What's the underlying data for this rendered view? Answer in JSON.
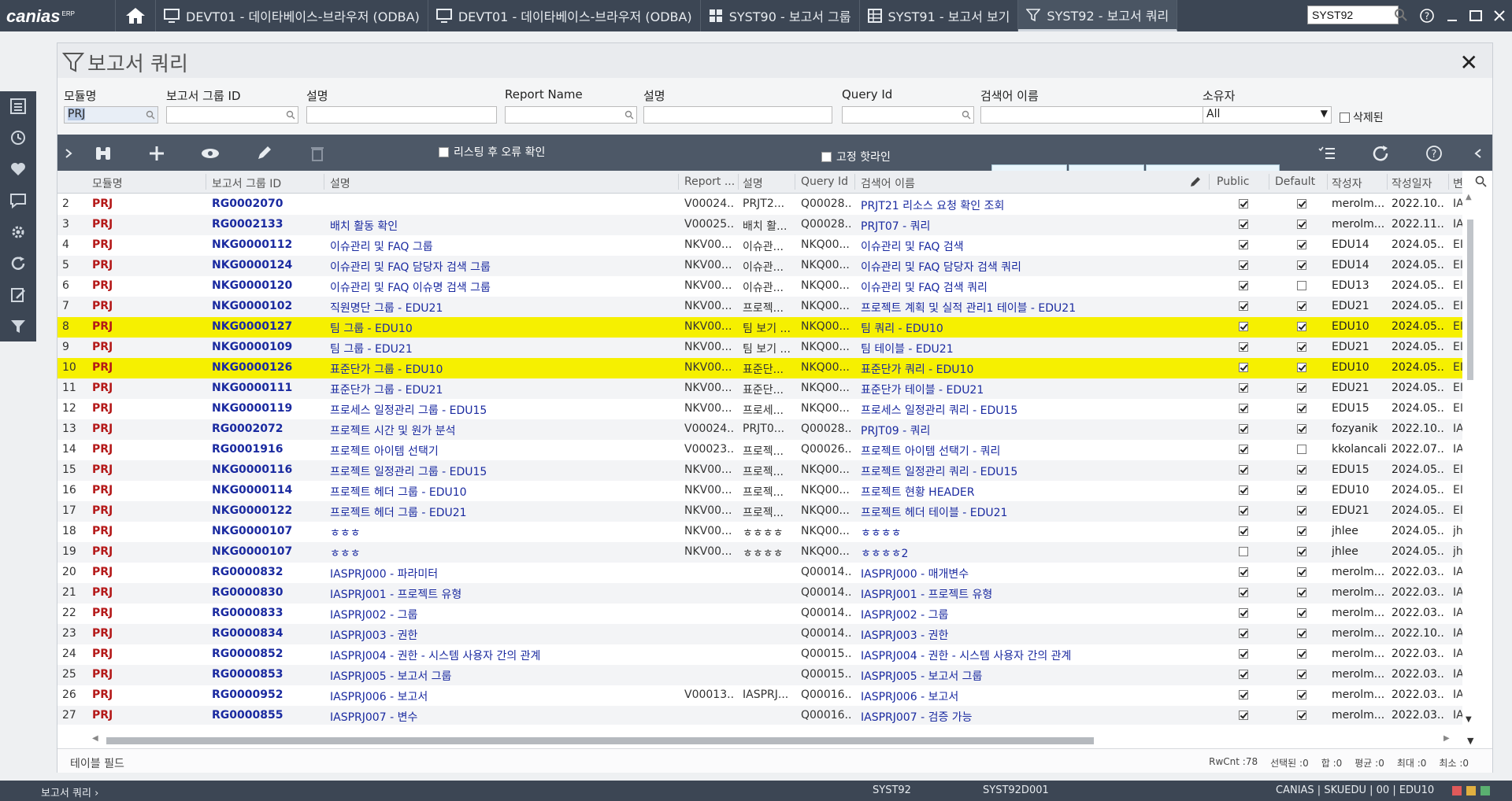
{
  "app": {
    "logo": "canias",
    "logo_sup": "ERP",
    "tabs": [
      {
        "label": "DEVT01 - 데이타베이스-브라우저 (ODBA)",
        "icon": "monitor-icon"
      },
      {
        "label": "DEVT01 - 데이타베이스-브라우저 (ODBA)",
        "icon": "monitor-icon"
      },
      {
        "label": "SYST90 - 보고서 그룹",
        "icon": "grid-icon"
      },
      {
        "label": "SYST91 - 보고서 보기",
        "icon": "table-icon"
      },
      {
        "label": "SYST92 - 보고서 쿼리",
        "icon": "filter-icon"
      }
    ],
    "global_search": "SYST92"
  },
  "panel": {
    "title": "보고서 쿼리"
  },
  "filters": {
    "module_label": "모듈명",
    "module_value": "PRJ",
    "group_id_label": "보고서 그룹 ID",
    "desc1_label": "설명",
    "report_name_label": "Report Name",
    "desc2_label": "설명",
    "query_id_label": "Query Id",
    "search_name_label": "검색어 이름",
    "owner_label": "소유자",
    "owner_value": "All",
    "deleted_label": "삭제된"
  },
  "toolbar": {
    "error_check_label": "리스팅 후 오류 확인",
    "fixed_row_label": "고정 핫라인"
  },
  "grid": {
    "columns": [
      "모듈명",
      "보고서 그룹 ID",
      "설명",
      "Report ...",
      "설명",
      "Query Id",
      "검색어 이름",
      "Public",
      "Default",
      "작성자",
      "작성일자",
      "변"
    ],
    "rows": [
      {
        "no": "2",
        "mod": "PRJ",
        "grp": "RG0002070",
        "desc": "",
        "rep": "V00024...",
        "desc2": "PRJT2...",
        "qid": "Q00028...",
        "srch": "PRJT21 리소스 요청 확인 조회",
        "pub": true,
        "def": true,
        "own": "merolm...",
        "date": "2022.10...",
        "x": "IA",
        "hl": false
      },
      {
        "no": "3",
        "mod": "PRJ",
        "grp": "RG0002133",
        "desc": "배치 활동 확인",
        "rep": "V00025...",
        "desc2": "배치 활...",
        "qid": "Q00028...",
        "srch": "PRJT07 - 쿼리",
        "pub": true,
        "def": true,
        "own": "merolm...",
        "date": "2022.11...",
        "x": "IA",
        "hl": false
      },
      {
        "no": "4",
        "mod": "PRJ",
        "grp": "NKG0000112",
        "desc": "이슈관리 및 FAQ 그룹",
        "rep": "NKV00...",
        "desc2": "이슈관...",
        "qid": "NKQ00...",
        "srch": "이슈관리 및 FAQ 검색",
        "pub": true,
        "def": true,
        "own": "EDU14",
        "date": "2024.05...",
        "x": "EI",
        "hl": false
      },
      {
        "no": "5",
        "mod": "PRJ",
        "grp": "NKG0000124",
        "desc": "이슈관리 및 FAQ 담당자 검색 그룹",
        "rep": "NKV00...",
        "desc2": "이슈관...",
        "qid": "NKQ00...",
        "srch": "이슈관리 및 FAQ 담당자 검색 쿼리",
        "pub": true,
        "def": true,
        "own": "EDU14",
        "date": "2024.05...",
        "x": "EI",
        "hl": false
      },
      {
        "no": "6",
        "mod": "PRJ",
        "grp": "NKG0000120",
        "desc": "이슈관리 및 FAQ 이슈명 검색 그룹",
        "rep": "NKV00...",
        "desc2": "이슈관...",
        "qid": "NKQ00...",
        "srch": "이슈관리 및 FAQ 검색 쿼리",
        "pub": true,
        "def": false,
        "own": "EDU13",
        "date": "2024.05...",
        "x": "EI",
        "hl": false
      },
      {
        "no": "7",
        "mod": "PRJ",
        "grp": "NKG0000102",
        "desc": "직원명단 그룹 - EDU21",
        "rep": "NKV00...",
        "desc2": "프로젝...",
        "qid": "NKQ00...",
        "srch": "프로젝트 계획 및 실적 관리1 테이블 - EDU21",
        "pub": true,
        "def": true,
        "own": "EDU21",
        "date": "2024.05...",
        "x": "EI",
        "hl": false
      },
      {
        "no": "8",
        "mod": "PRJ",
        "grp": "NKG0000127",
        "desc": "팀 그룹 - EDU10",
        "rep": "NKV00...",
        "desc2": "팀 보기 ...",
        "qid": "NKQ00...",
        "srch": "팀 쿼리 - EDU10",
        "pub": true,
        "def": true,
        "own": "EDU10",
        "date": "2024.05...",
        "x": "EI",
        "hl": true
      },
      {
        "no": "9",
        "mod": "PRJ",
        "grp": "NKG0000109",
        "desc": "팀 그룹 - EDU21",
        "rep": "NKV00...",
        "desc2": "팀 보기 ...",
        "qid": "NKQ00...",
        "srch": "팀 테이블 - EDU21",
        "pub": true,
        "def": true,
        "own": "EDU21",
        "date": "2024.05...",
        "x": "EI",
        "hl": false
      },
      {
        "no": "10",
        "mod": "PRJ",
        "grp": "NKG0000126",
        "desc": "표준단가 그룹 - EDU10",
        "rep": "NKV00...",
        "desc2": "표준단...",
        "qid": "NKQ00...",
        "srch": "표준단가 쿼리 - EDU10",
        "pub": true,
        "def": true,
        "own": "EDU10",
        "date": "2024.05...",
        "x": "EI",
        "hl": true
      },
      {
        "no": "11",
        "mod": "PRJ",
        "grp": "NKG0000111",
        "desc": "표준단가 그룹 - EDU21",
        "rep": "NKV00...",
        "desc2": "표준단...",
        "qid": "NKQ00...",
        "srch": "표준단가 테이블 - EDU21",
        "pub": true,
        "def": true,
        "own": "EDU21",
        "date": "2024.05...",
        "x": "EI",
        "hl": false
      },
      {
        "no": "12",
        "mod": "PRJ",
        "grp": "NKG0000119",
        "desc": "프로세스 일정관리  그룹 - EDU15",
        "rep": "NKV00...",
        "desc2": "프로세...",
        "qid": "NKQ00...",
        "srch": "프로세스 일정관리 쿼리 - EDU15",
        "pub": true,
        "def": true,
        "own": "EDU15",
        "date": "2024.05...",
        "x": "EI",
        "hl": false
      },
      {
        "no": "13",
        "mod": "PRJ",
        "grp": "RG0002072",
        "desc": "프로젝트 시간 및 원가 분석",
        "rep": "V00024...",
        "desc2": "PRJT0...",
        "qid": "Q00028...",
        "srch": "PRJT09 - 쿼리",
        "pub": true,
        "def": true,
        "own": "fozyanik",
        "date": "2022.10...",
        "x": "IA",
        "hl": false
      },
      {
        "no": "14",
        "mod": "PRJ",
        "grp": "RG0001916",
        "desc": "프로젝트 아이템 선택기",
        "rep": "V00023...",
        "desc2": "프로젝...",
        "qid": "Q00026...",
        "srch": "프로젝트 아이템 선택기 - 쿼리",
        "pub": true,
        "def": false,
        "own": "kkolancali",
        "date": "2022.07...",
        "x": "IA",
        "hl": false
      },
      {
        "no": "15",
        "mod": "PRJ",
        "grp": "NKG0000116",
        "desc": "프로젝트 일정관리  그룹 - EDU15",
        "rep": "NKV00...",
        "desc2": "프로젝...",
        "qid": "NKQ00...",
        "srch": "프로젝트 일정관리 쿼리 - EDU15",
        "pub": true,
        "def": true,
        "own": "EDU15",
        "date": "2024.05...",
        "x": "EI",
        "hl": false
      },
      {
        "no": "16",
        "mod": "PRJ",
        "grp": "NKG0000114",
        "desc": "프로젝트 헤더 그룹 - EDU10",
        "rep": "NKV00...",
        "desc2": "프로젝...",
        "qid": "NKQ00...",
        "srch": "프로젝트 현황 HEADER",
        "pub": true,
        "def": true,
        "own": "EDU10",
        "date": "2024.05...",
        "x": "EI",
        "hl": false
      },
      {
        "no": "17",
        "mod": "PRJ",
        "grp": "NKG0000122",
        "desc": "프로젝트 헤더 그룹 - EDU21",
        "rep": "NKV00...",
        "desc2": "프로젝...",
        "qid": "NKQ00...",
        "srch": "프로젝트 헤더 테이블 - EDU21",
        "pub": true,
        "def": true,
        "own": "EDU21",
        "date": "2024.05...",
        "x": "EI",
        "hl": false
      },
      {
        "no": "18",
        "mod": "PRJ",
        "grp": "NKG0000107",
        "desc": "ㅎㅎㅎ",
        "rep": "NKV00...",
        "desc2": "ㅎㅎㅎㅎ",
        "qid": "NKQ00...",
        "srch": "ㅎㅎㅎㅎ",
        "pub": true,
        "def": true,
        "own": "jhlee",
        "date": "2024.05...",
        "x": "jh",
        "hl": false
      },
      {
        "no": "19",
        "mod": "PRJ",
        "grp": "NKG0000107",
        "desc": "ㅎㅎㅎ",
        "rep": "NKV00...",
        "desc2": "ㅎㅎㅎㅎ",
        "qid": "NKQ00...",
        "srch": "ㅎㅎㅎㅎ2",
        "pub": false,
        "def": true,
        "own": "jhlee",
        "date": "2024.05...",
        "x": "jh",
        "hl": false
      },
      {
        "no": "20",
        "mod": "PRJ",
        "grp": "RG0000832",
        "desc": "IASPRJ000 - 파라미터",
        "rep": "",
        "desc2": "",
        "qid": "Q00014...",
        "srch": "IASPRJ000 - 매개변수",
        "pub": true,
        "def": true,
        "own": "merolm...",
        "date": "2022.03...",
        "x": "IA",
        "hl": false
      },
      {
        "no": "21",
        "mod": "PRJ",
        "grp": "RG0000830",
        "desc": "IASPRJ001 - 프로젝트 유형",
        "rep": "",
        "desc2": "",
        "qid": "Q00014...",
        "srch": "IASPRJ001 - 프로젝트 유형",
        "pub": true,
        "def": true,
        "own": "merolm...",
        "date": "2022.03...",
        "x": "IA",
        "hl": false
      },
      {
        "no": "22",
        "mod": "PRJ",
        "grp": "RG0000833",
        "desc": "IASPRJ002 - 그룹",
        "rep": "",
        "desc2": "",
        "qid": "Q00014...",
        "srch": "IASPRJ002 - 그룹",
        "pub": true,
        "def": true,
        "own": "merolm...",
        "date": "2022.03...",
        "x": "IA",
        "hl": false
      },
      {
        "no": "23",
        "mod": "PRJ",
        "grp": "RG0000834",
        "desc": "IASPRJ003 - 권한",
        "rep": "",
        "desc2": "",
        "qid": "Q00014...",
        "srch": "IASPRJ003 - 권한",
        "pub": true,
        "def": true,
        "own": "merolm...",
        "date": "2022.10...",
        "x": "IA",
        "hl": false
      },
      {
        "no": "24",
        "mod": "PRJ",
        "grp": "RG0000852",
        "desc": "IASPRJ004 - 권한 - 시스템 사용자 간의 관계",
        "rep": "",
        "desc2": "",
        "qid": "Q00015...",
        "srch": "IASPRJ004 - 권한 - 시스템 사용자 간의 관계",
        "pub": true,
        "def": true,
        "own": "merolm...",
        "date": "2022.03...",
        "x": "IA",
        "hl": false
      },
      {
        "no": "25",
        "mod": "PRJ",
        "grp": "RG0000853",
        "desc": "IASPRJ005 - 보고서 그룹",
        "rep": "",
        "desc2": "",
        "qid": "Q00015...",
        "srch": "IASPRJ005 - 보고서 그룹",
        "pub": true,
        "def": true,
        "own": "merolm...",
        "date": "2022.03...",
        "x": "IA",
        "hl": false
      },
      {
        "no": "26",
        "mod": "PRJ",
        "grp": "RG0000952",
        "desc": "IASPRJ006 - 보고서",
        "rep": "V00013...",
        "desc2": "IASPRJ...",
        "qid": "Q00016...",
        "srch": "IASPRJ006 - 보고서",
        "pub": true,
        "def": true,
        "own": "merolm...",
        "date": "2022.03...",
        "x": "IA",
        "hl": false
      },
      {
        "no": "27",
        "mod": "PRJ",
        "grp": "RG0000855",
        "desc": "IASPRJ007 - 변수",
        "rep": "",
        "desc2": "",
        "qid": "Q00016...",
        "srch": "IASPRJ007 - 검증 가능",
        "pub": true,
        "def": true,
        "own": "merolm...",
        "date": "2022.03...",
        "x": "IA",
        "hl": false
      }
    ]
  },
  "footer": {
    "left": "테이블 필드",
    "rwcnt": "RwCnt :78",
    "selected": "선택된 :0",
    "sum": "합 :0",
    "avg": "평균 :0",
    "max": "최대 :0",
    "min": "최소 :0"
  },
  "status": {
    "breadcrumb": "보고서 쿼리",
    "prog": "SYST92",
    "form": "SYST92D001",
    "session": "CANIAS | SKUEDU | 00 | EDU10"
  },
  "colors": {
    "chrome": "#3c4654",
    "toolbar": "#4d5867",
    "highlight": "#f6f000",
    "module_red": "#b41818",
    "link_blue": "#1a2aa0"
  }
}
